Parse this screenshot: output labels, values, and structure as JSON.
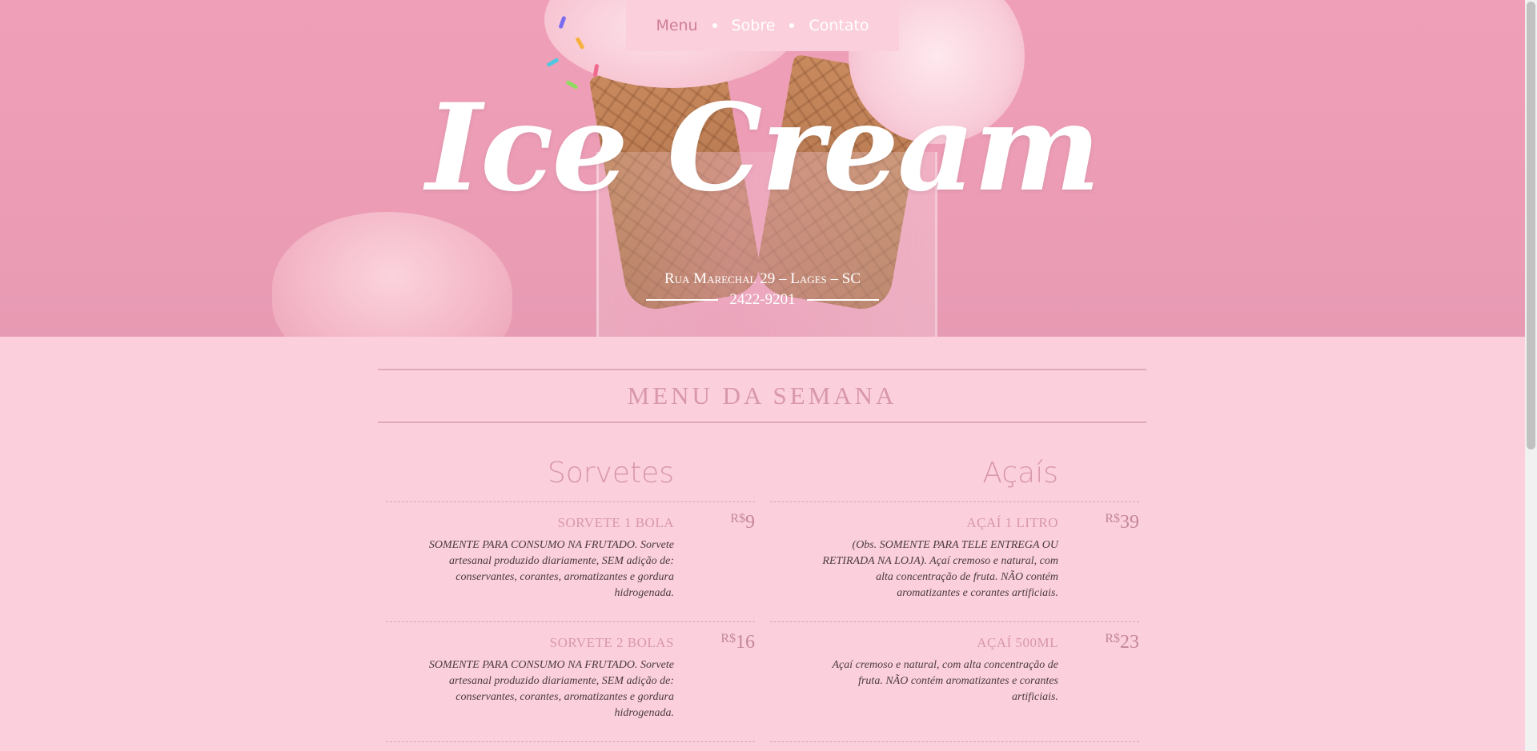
{
  "nav": {
    "items": [
      {
        "label": "Menu",
        "active": true
      },
      {
        "label": "Sobre",
        "active": false
      },
      {
        "label": "Contato",
        "active": false
      }
    ]
  },
  "hero": {
    "title": "Ice Cream",
    "address": "Rua Marechal 29 – Lages – SC",
    "phone": "2422-9201"
  },
  "menu": {
    "header": "MENU DA SEMANA",
    "columns": [
      {
        "title": "Sorvetes",
        "items": [
          {
            "name": "SORVETE 1 BOLA",
            "currency": "R$",
            "price": "9",
            "description": "SOMENTE PARA CONSUMO NA FRUTADO. Sorvete artesanal produzido diariamente, SEM adição de: conservantes, corantes, aromatizantes e gordura hidrogenada."
          },
          {
            "name": "SORVETE 2 BOLAS",
            "currency": "R$",
            "price": "16",
            "description": "SOMENTE PARA CONSUMO NA FRUTADO. Sorvete artesanal produzido diariamente, SEM adição de: conservantes, corantes, aromatizantes e gordura hidrogenada."
          }
        ]
      },
      {
        "title": "Açaís",
        "items": [
          {
            "name": "AÇAÍ 1 LITRO",
            "currency": "R$",
            "price": "39",
            "description": "(Obs. SOMENTE PARA TELE ENTREGA OU RETIRADA NA LOJA). Açaí cremoso e natural, com alta concentração de fruta. NÃO contém aromatizantes e corantes artificiais."
          },
          {
            "name": "AÇAÍ 500ML",
            "currency": "R$",
            "price": "23",
            "description": "Açaí cremoso e natural, com alta concentração de fruta. NÃO contém aromatizantes e corantes artificiais."
          }
        ]
      }
    ]
  },
  "colors": {
    "background": "#fbd0dc",
    "accent": "#d897aa",
    "hero": "#ec9db5",
    "nav_active": "#d07e96"
  },
  "icons": [
    "nav-dot-icon",
    "nav-dot-icon"
  ]
}
